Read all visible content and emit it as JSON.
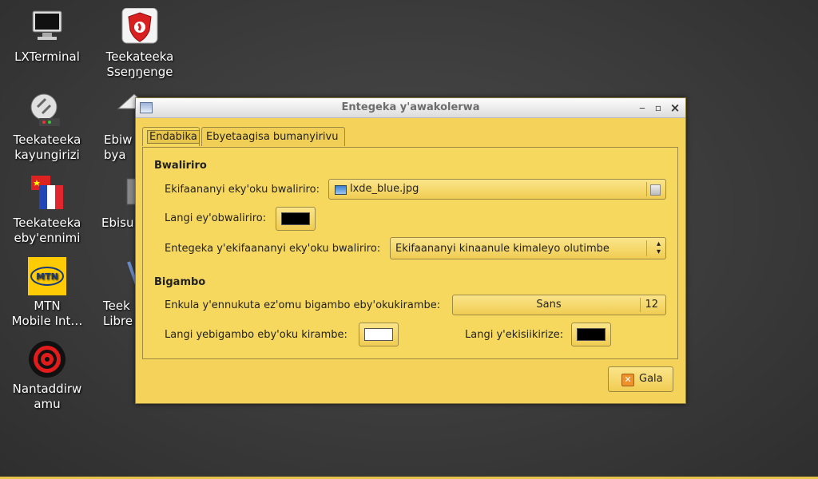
{
  "desktop": {
    "icons": [
      {
        "label": "LXTerminal",
        "icon": "terminal-icon"
      },
      {
        "label": "Teekateeka\nSseŋŋenge",
        "icon": "firewall-shield-icon"
      },
      {
        "label": "Teekateeka\nkayungirizi",
        "icon": "network-settings-icon"
      },
      {
        "label": "Ebiw\nbya",
        "icon": "home-folder-icon"
      },
      {
        "label": "Teekateeka\neby'ennimi",
        "icon": "language-flag-icon"
      },
      {
        "label": "Ebisu",
        "icon": "trash-icon"
      },
      {
        "label": "MTN\nMobile Int…",
        "icon": "mtn-logo-icon"
      },
      {
        "label": "Teek\nLibre",
        "icon": "libreoffice-icon"
      },
      {
        "label": "Nantaddirw\namu",
        "icon": "target-icon"
      }
    ]
  },
  "window": {
    "title": "Entegeka y'awakolerwa",
    "tabs": [
      "Endabika",
      "Ebyetaagisa bumanyirivu"
    ],
    "background_section": {
      "heading": "Bwaliriro",
      "wallpaper_label": "Ekifaananyi eky'oku bwaliriro:",
      "wallpaper_value": "lxde_blue.jpg",
      "bgcolor_label": "Langi ey'obwaliriro:",
      "bgcolor": "#000000",
      "mode_label": "Entegeka y'ekifaananyi eky'oku bwaliriro:",
      "mode_value": "Ekifaananyi kinaanule kimaleyo olutimbe"
    },
    "text_section": {
      "heading": "Bigambo",
      "font_label": "Enkula y'ennukuta ez'omu bigambo eby'okukirambe:",
      "font_name": "Sans",
      "font_size": "12",
      "text_color_label": "Langi yebigambo eby'oku kirambe:",
      "text_color": "#ffffff",
      "shadow_color_label": "Langi y'ekisiikirize:",
      "shadow_color": "#000000"
    },
    "close_button": "Gala"
  },
  "colors": {
    "accent": "#f5d35a",
    "desktop": "#3b3b3b"
  }
}
